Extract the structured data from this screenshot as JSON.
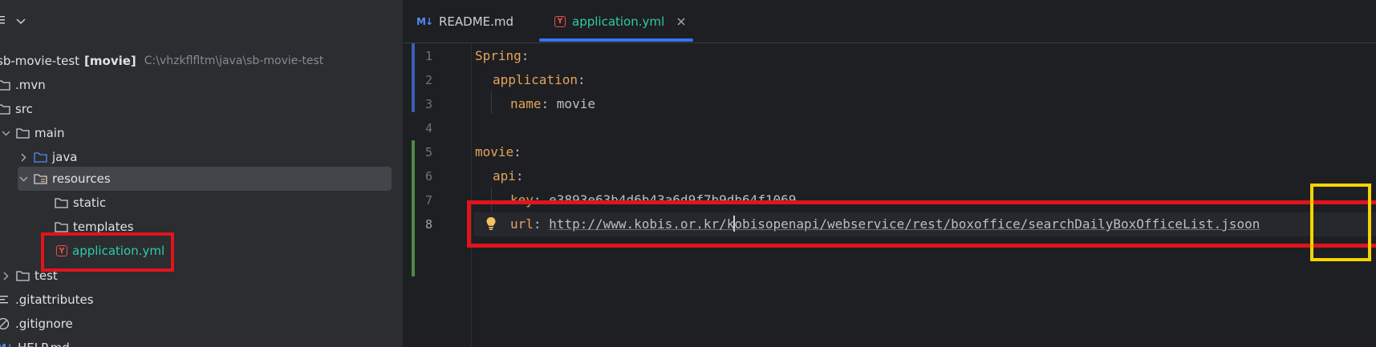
{
  "project": {
    "toolbar_icon": "menu-icon",
    "root": {
      "name": "sb-movie-test",
      "module": "[movie]",
      "path": "C:\\vhzkflfltm\\java\\sb-movie-test"
    },
    "tree": [
      {
        "label": ".mvn"
      },
      {
        "label": "src"
      },
      {
        "label": "main"
      },
      {
        "label": "java"
      },
      {
        "label": "resources"
      },
      {
        "label": "static"
      },
      {
        "label": "templates"
      },
      {
        "label": "application.yml"
      },
      {
        "label": "test"
      },
      {
        "label": ".gitattributes"
      },
      {
        "label": ".gitignore"
      },
      {
        "label": "HELP.md"
      }
    ]
  },
  "tabs": [
    {
      "label": "README.md",
      "icon": "markdown-icon",
      "icon_text": "M↓"
    },
    {
      "label": "application.yml",
      "icon": "yaml-icon",
      "icon_text": "Y",
      "active": true
    }
  ],
  "editor": {
    "line_numbers": [
      "1",
      "2",
      "3",
      "4",
      "5",
      "6",
      "7",
      "8"
    ],
    "lines": [
      {
        "key": "Spring",
        "sep": ":"
      },
      {
        "key": "application",
        "sep": ":"
      },
      {
        "key": "name",
        "sep": ": ",
        "value": "movie"
      },
      {
        "key": "",
        "sep": ""
      },
      {
        "key": "movie",
        "sep": ":"
      },
      {
        "key": "api",
        "sep": ":"
      },
      {
        "key": "key",
        "sep": ": ",
        "value": "e3893e63b4d6b43a6d9f7b9db64f1069"
      },
      {
        "key": "url",
        "sep": ": ",
        "value_a": "http://www.kobis.or.kr/k",
        "value_b": "obisopenapi/webservice/rest/boxoffice/searchDailyBoxOfficeList",
        "value_c": ".jsoon"
      }
    ]
  },
  "colors": {
    "highlight_red": "#e0141c",
    "highlight_yellow": "#f5d400",
    "accent": "#3574f0"
  }
}
